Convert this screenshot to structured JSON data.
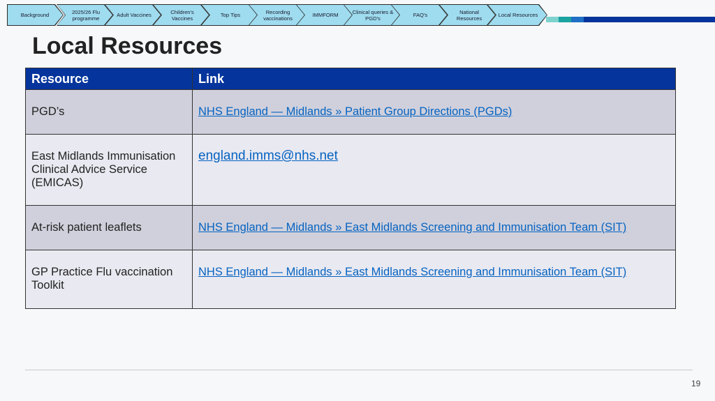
{
  "nav": [
    {
      "label": "Background"
    },
    {
      "label": "2025/26 Flu programme"
    },
    {
      "label": "Adult Vaccines"
    },
    {
      "label": "Children's Vaccines"
    },
    {
      "label": "Top Tips"
    },
    {
      "label": "Recording vaccinations"
    },
    {
      "label": "IMMFORM"
    },
    {
      "label": "Clinical queries & PGD's"
    },
    {
      "label": "FAQ's"
    },
    {
      "label": "National Resources"
    },
    {
      "label": "Local Resources"
    }
  ],
  "colors": {
    "nav_fill": "#9fdcef",
    "header_bg": "#04349c",
    "link": "#0563c1",
    "row_dark": "#d0d0dc",
    "row_light": "#e9e9f1"
  },
  "title": "Local Resources",
  "table": {
    "headers": {
      "resource": "Resource",
      "link": "Link"
    },
    "rows": [
      {
        "resource": "PGD’s",
        "link": "NHS England — Midlands » Patient Group Directions (PGDs)"
      },
      {
        "resource": "East Midlands Immunisation Clinical Advice Service (EMICAS)",
        "link": "england.imms@nhs.net"
      },
      {
        "resource": "At-risk patient leaflets",
        "link": "NHS England — Midlands » East Midlands Screening and Immunisation Team (SIT)"
      },
      {
        "resource": "GP Practice Flu vaccination Toolkit",
        "link": "NHS England — Midlands » East Midlands Screening and Immunisation Team (SIT)"
      }
    ]
  },
  "page_number": "19"
}
